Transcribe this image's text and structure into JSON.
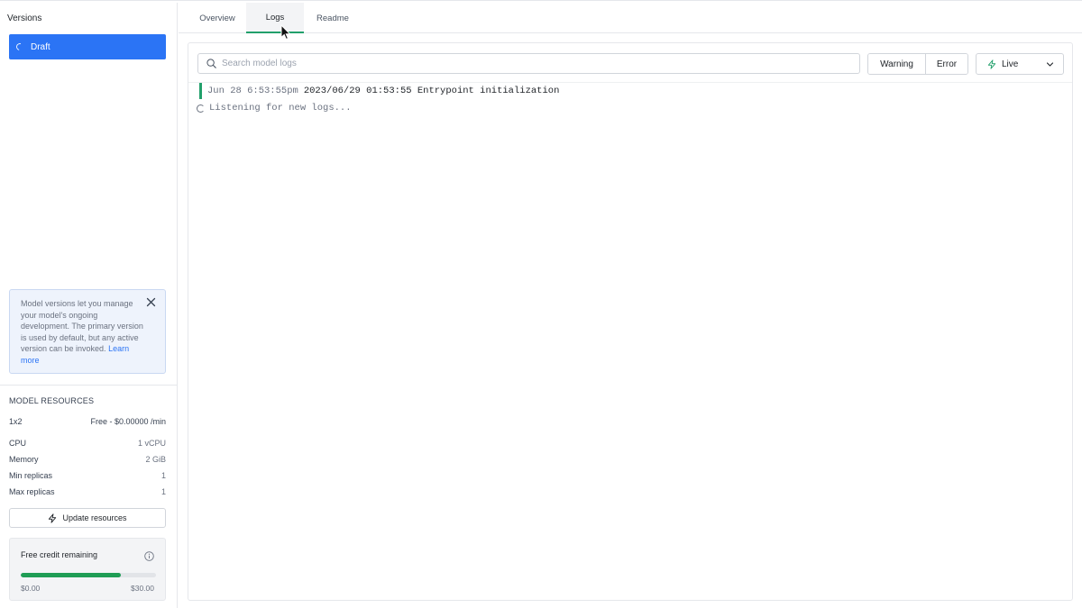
{
  "sidebar": {
    "title": "Versions",
    "versions": [
      {
        "label": "Draft",
        "selected": true
      }
    ],
    "info": {
      "text": "Model versions let you manage your model's ongoing development. The primary version is used by default, but any active version can be invoked.",
      "link": "Learn more"
    },
    "resources": {
      "title": "MODEL RESOURCES",
      "instance": {
        "label": "1x2",
        "value": "Free - $0.00000 /min"
      },
      "rows": [
        {
          "label": "CPU",
          "value": "1 vCPU"
        },
        {
          "label": "Memory",
          "value": "2 GiB"
        },
        {
          "label": "Min replicas",
          "value": "1"
        },
        {
          "label": "Max replicas",
          "value": "1"
        }
      ],
      "update_button": "Update resources"
    },
    "credit": {
      "title": "Free credit remaining",
      "min_label": "$0.00",
      "max_label": "$30.00",
      "remaining_fraction": 0.74
    }
  },
  "tabs": [
    {
      "label": "Overview",
      "active": false
    },
    {
      "label": "Logs",
      "active": true
    },
    {
      "label": "Readme",
      "active": false
    }
  ],
  "logs": {
    "search_placeholder": "Search model logs",
    "filters": [
      "Warning",
      "Error"
    ],
    "live_label": "Live",
    "entries": [
      {
        "timestamp": "Jun 28 6:53:55pm",
        "message": "2023/06/29 01:53:55 Entrypoint initialization"
      }
    ],
    "listening_text": "Listening for new logs..."
  },
  "colors": {
    "accent": "#2b74f5",
    "success": "#22a06b",
    "progress": "#1f9d55"
  }
}
